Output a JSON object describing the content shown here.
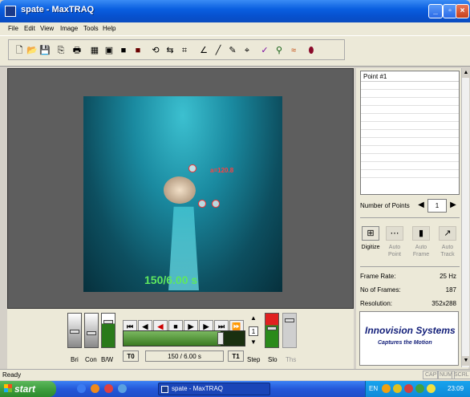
{
  "window": {
    "title": "spate - MaxTRAQ"
  },
  "menu": [
    "File",
    "Edit",
    "View",
    "Image",
    "Tools",
    "Help"
  ],
  "toolbar_icons": [
    "new-file-icon",
    "open-folder-icon",
    "save-icon",
    "copy-icon",
    "print-icon",
    "grid-icon",
    "tile-icon",
    "film-icon",
    "film-color-icon",
    "rotate-icon",
    "flip-icon",
    "crop-icon",
    "angle-tool-icon",
    "line-tool-icon",
    "measure-tool-icon",
    "point-tool-icon",
    "check-tool-icon",
    "skeleton-icon",
    "wave-graph-icon",
    "eraser-icon"
  ],
  "video": {
    "overlay_text": "150/6.00 s",
    "angle_label": "a=120.8"
  },
  "points_list": {
    "header": "Point #1"
  },
  "num_points": {
    "label": "Number of Points",
    "value": "1"
  },
  "digitize": [
    {
      "label": "Digitize",
      "active": true
    },
    {
      "label": "Auto\nPoint",
      "active": false
    },
    {
      "label": "Auto\nFrame",
      "active": false
    },
    {
      "label": "Auto\nTrack",
      "active": false
    }
  ],
  "info": {
    "frame_rate_label": "Frame Rate:",
    "frame_rate_value": "25 Hz",
    "no_frames_label": "No of Frames:",
    "no_frames_value": "187",
    "resolution_label": "Resolution:",
    "resolution_value": "352x288"
  },
  "logo": {
    "title": "Innovision Systems",
    "subtitle": "Captures the Motion"
  },
  "sliders": {
    "bri": "Bri",
    "con": "Con",
    "bw": "B/W",
    "slo": "Slo",
    "ths": "Ths",
    "step": "Step"
  },
  "playback": {
    "t0": "T0",
    "t1": "T1",
    "frame_display": "150 / 6.00 s",
    "step_value": "1",
    "progress": 0.8
  },
  "status": {
    "text": "Ready",
    "keys": [
      "CAP",
      "NUM",
      "SCRL"
    ]
  },
  "taskbar": {
    "start": "start",
    "app": "spate - MaxTRAQ",
    "lang": "EN",
    "clock": "23:09"
  },
  "colors": {
    "title_blue": "#0a5fe0",
    "overlay_green": "#5fe85f",
    "marker_red": "#ff3030",
    "logo_navy": "#14207a"
  }
}
